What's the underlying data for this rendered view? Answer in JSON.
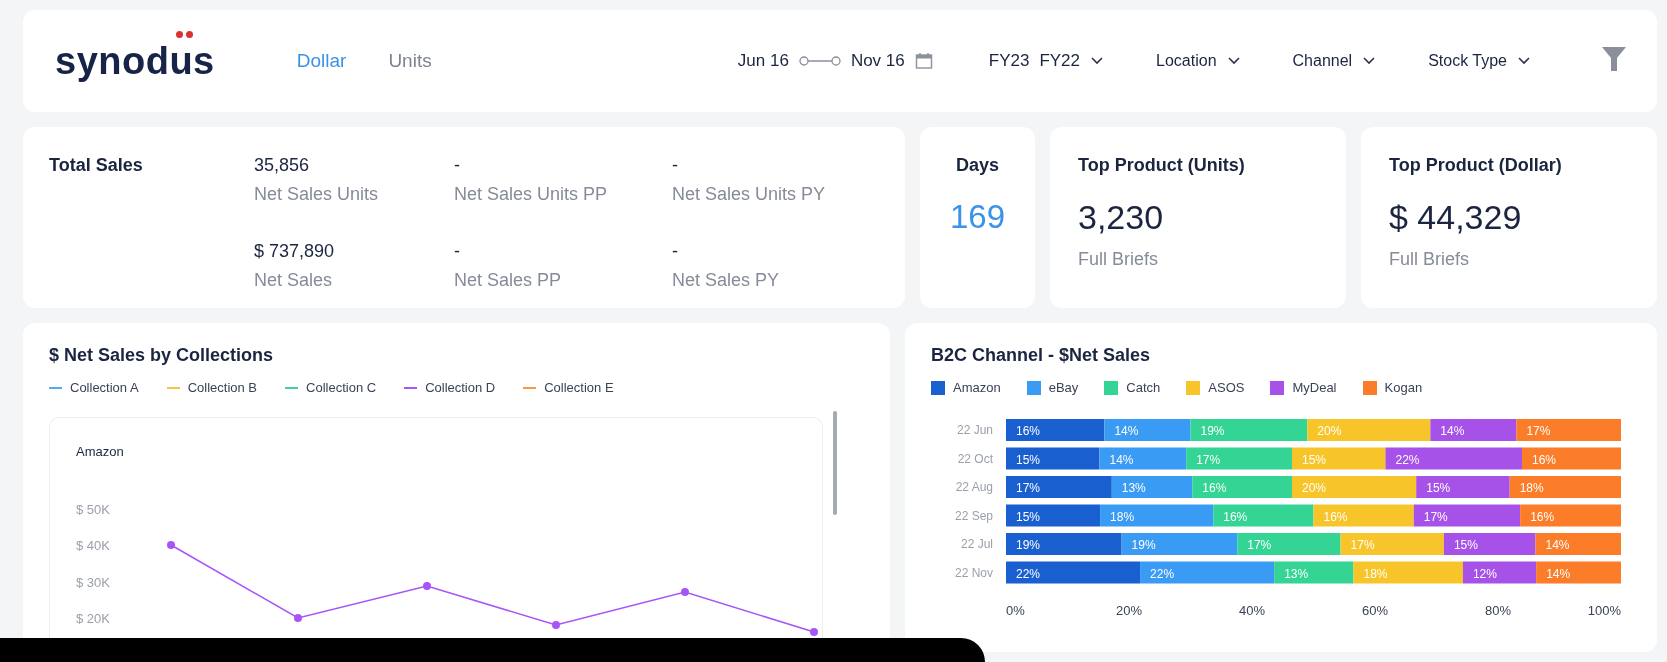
{
  "header": {
    "logo": "synodus",
    "tabs": [
      {
        "label": "Dollar",
        "selected": true
      },
      {
        "label": "Units",
        "selected": false
      }
    ],
    "date_range": {
      "start": "Jun 16",
      "end": "Nov 16"
    },
    "fiscal_years": [
      "FY23",
      "FY22"
    ],
    "filters": [
      {
        "label": "Location"
      },
      {
        "label": "Channel"
      },
      {
        "label": "Stock Type"
      }
    ]
  },
  "total_sales": {
    "title": "Total Sales",
    "metrics": [
      {
        "value": "35,856",
        "label": "Net Sales Units"
      },
      {
        "value": "-",
        "label": "Net Sales Units PP"
      },
      {
        "value": "-",
        "label": "Net Sales Units PY"
      },
      {
        "value": "$ 737,890",
        "label": "Net Sales"
      },
      {
        "value": "-",
        "label": "Net Sales PP"
      },
      {
        "value": "-",
        "label": "Net Sales PY"
      }
    ]
  },
  "days": {
    "title": "Days",
    "value": "169"
  },
  "top_products": [
    {
      "title": "Top Product (Units)",
      "value": "3,230",
      "caption": "Full Briefs"
    },
    {
      "title": "Top Product (Dollar)",
      "value": "$ 44,329",
      "caption": "Full Briefs"
    }
  ],
  "collections": {
    "title": "$ Net Sales by Collections",
    "legend": [
      {
        "kind": "static",
        "name": "Collection A",
        "color": "#5aa9e6"
      },
      {
        "kind": "static",
        "name": "Collection B",
        "color": "#f5c542"
      },
      {
        "kind": "static",
        "name": "Collection C",
        "color": "#3fcfa5"
      },
      {
        "kind": "static",
        "name": "Collection D",
        "color": "#a855f7"
      },
      {
        "kind": "static",
        "name": "Collection E",
        "color": "#f59a4a"
      }
    ],
    "panel_title": "Amazon",
    "axis_labels": [
      "$ 50K",
      "$ 40K",
      "$ 30K",
      "$ 20K"
    ]
  },
  "channel": {
    "title": "B2C Channel - $Net Sales",
    "chart_data": {
      "type": "bar",
      "orientation": "horizontal",
      "stacked": true,
      "data_labels": true,
      "categories": [
        "22 Jun",
        "22 Oct",
        "22 Aug",
        "22 Sep",
        "22 Jul",
        "22 Nov"
      ],
      "xlim": [
        0,
        100
      ],
      "xticks": [
        {
          "value": 0,
          "label": "0%"
        },
        {
          "value": 20,
          "label": "20%"
        },
        {
          "value": 40,
          "label": "40%"
        },
        {
          "value": 60,
          "label": "60%"
        },
        {
          "value": 80,
          "label": "80%"
        },
        {
          "value": 100,
          "label": "100%"
        }
      ],
      "series": [
        {
          "name": "Amazon",
          "color": "#1a5fd0",
          "values": [
            16,
            15.2,
            17.2,
            15.3,
            18.8,
            21.8
          ],
          "value_labels": [
            "16%",
            "15%",
            "17%",
            "15%",
            "19%",
            "22%"
          ]
        },
        {
          "name": "eBay",
          "color": "#3a9bf5",
          "values": [
            14,
            14.1,
            13.1,
            18.4,
            18.8,
            21.8
          ],
          "value_labels": [
            "14%",
            "14%",
            "13%",
            "18%",
            "19%",
            "22%"
          ]
        },
        {
          "name": "Catch",
          "color": "#33d494",
          "values": [
            19,
            17.2,
            16.2,
            16.3,
            16.8,
            12.9
          ],
          "value_labels": [
            "19%",
            "17%",
            "16%",
            "16%",
            "17%",
            "13%"
          ]
        },
        {
          "name": "ASOS",
          "color": "#f7c52a",
          "values": [
            20,
            15.2,
            20.2,
            16.3,
            16.8,
            17.8
          ],
          "value_labels": [
            "20%",
            "15%",
            "20%",
            "16%",
            "17%",
            "18%"
          ]
        },
        {
          "name": "MyDeal",
          "color": "#a652e8",
          "values": [
            14,
            22.2,
            15.2,
            17.3,
            14.9,
            11.9
          ],
          "value_labels": [
            "14%",
            "22%",
            "15%",
            "17%",
            "15%",
            "12%"
          ]
        },
        {
          "name": "Kogan",
          "color": "#fb7d2a",
          "values": [
            17,
            16.1,
            18.1,
            16.4,
            13.9,
            13.8
          ],
          "value_labels": [
            "17%",
            "16%",
            "18%",
            "16%",
            "14%",
            "14%"
          ]
        }
      ]
    }
  }
}
